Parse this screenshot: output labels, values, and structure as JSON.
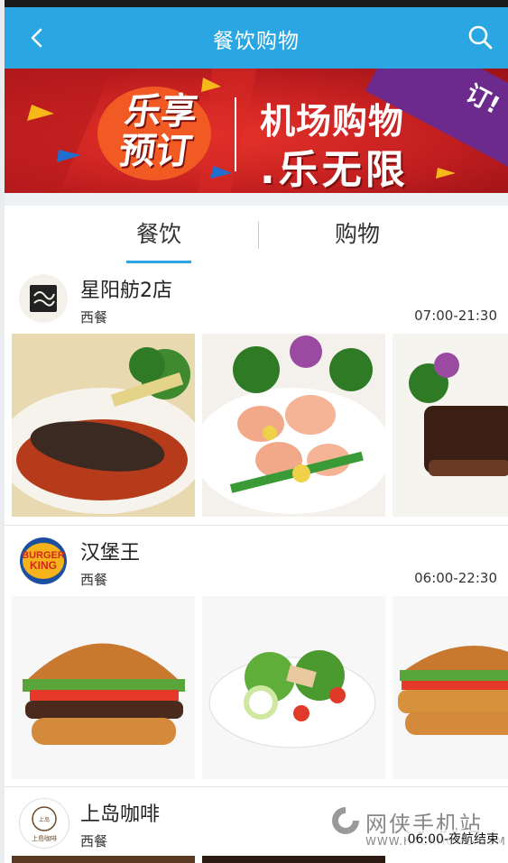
{
  "header": {
    "title": "餐饮购物",
    "back_icon": "chevron-left-icon",
    "search_icon": "search-icon",
    "color": "#2aa7e3"
  },
  "banner": {
    "left_slogan_line1": "乐享",
    "left_slogan_line2": "预订",
    "right_slogan_line1": "机场购物",
    "right_slogan_line2": ".乐无限",
    "ribbon_text": "订!"
  },
  "tabs": [
    {
      "label": "餐饮",
      "active": true
    },
    {
      "label": "购物",
      "active": false
    }
  ],
  "restaurants": [
    {
      "name": "星阳舫2店",
      "category": "西餐",
      "hours": "07:00-21:30",
      "logo": "xingyangfang-logo",
      "images": [
        "sea-cucumber-dish",
        "shrimp-vegetable-dish",
        "braised-beef-dish"
      ]
    },
    {
      "name": "汉堡王",
      "category": "西餐",
      "hours": "06:00-22:30",
      "logo": "burger-king-logo",
      "logo_text": [
        "BURGER",
        "KING"
      ],
      "images": [
        "whopper-burger",
        "garden-salad",
        "chicken-burger"
      ]
    },
    {
      "name": "上岛咖啡",
      "category": "西餐",
      "hours": "",
      "logo": "ueshima-coffee-logo",
      "logo_text": [
        "上岛",
        "上島咖啡"
      ],
      "images": []
    }
  ],
  "watermark": {
    "cn": "网侠手机站",
    "en": "WWW.HACKHOME.COM"
  },
  "overlay_label": "06:00-夜航结束"
}
